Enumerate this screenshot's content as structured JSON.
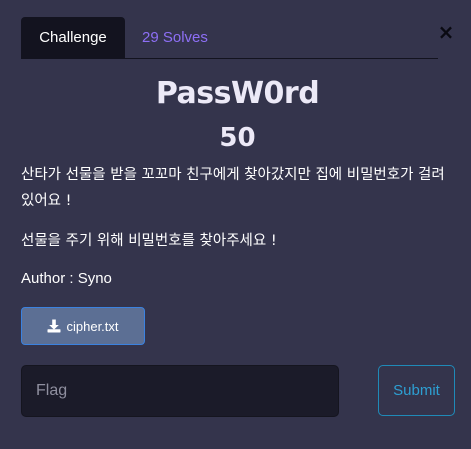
{
  "tabs": {
    "challenge": "Challenge",
    "solves": "29 Solves"
  },
  "close_symbol": "×",
  "challenge": {
    "name": "PassW0rd",
    "points": "50",
    "description_1": "산타가 선물을 받을 꼬꼬마 친구에게 찾아갔지만 집에 비밀번호가 걸려있어요 !",
    "description_2": "선물을 주기 위해 비밀번호를 찾아주세요 !",
    "author": "Author : Syno"
  },
  "file": {
    "icon": "download-icon",
    "label": "cipher.txt"
  },
  "flag_input": {
    "placeholder": "Flag",
    "value": ""
  },
  "submit_label": "Submit",
  "colors": {
    "background": "#34344c",
    "tab_active": "#13131f",
    "tab_link": "#8d6ff5",
    "file_button": "#5c6f94",
    "submit_border": "#1f8ab8"
  }
}
